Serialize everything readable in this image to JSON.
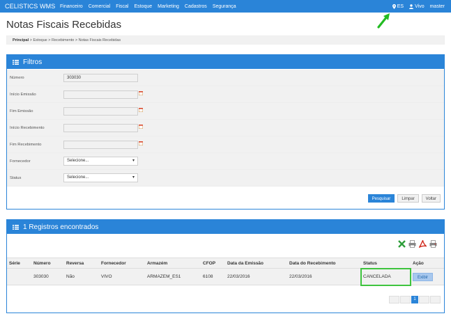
{
  "navbar": {
    "brand": "CELISTICS WMS",
    "menu": [
      "Financeiro",
      "Comercial",
      "Fiscal",
      "Estoque",
      "Marketing",
      "Cadastros",
      "Segurança"
    ],
    "location": "ES",
    "company": "Vivo",
    "user": "master"
  },
  "page": {
    "title": "Notas Fiscais Recebidas"
  },
  "breadcrumb": {
    "home": "Principal",
    "rest": " > Estoque > Recebimento > Notas Fiscais Recebidas"
  },
  "filters": {
    "title": "Filtros",
    "numero": {
      "label": "Número",
      "value": "303030"
    },
    "inicio_emissao": {
      "label": "Início Emissão",
      "value": ""
    },
    "fim_emissao": {
      "label": "Fim Emissão",
      "value": ""
    },
    "inicio_recebimento": {
      "label": "Início Recebimento",
      "value": ""
    },
    "fim_recebimento": {
      "label": "Fim Recebimento",
      "value": ""
    },
    "fornecedor": {
      "label": "Fornecedor",
      "value": "Selecione..."
    },
    "status": {
      "label": "Status",
      "value": "Selecione..."
    },
    "buttons": {
      "pesquisar": "Pesquisar",
      "limpar": "Limpar",
      "voltar": "Voltar"
    }
  },
  "results": {
    "title": "1 Registros encontrados",
    "tool_icons": [
      "excel-icon",
      "print-icon",
      "pdf-icon",
      "print-icon"
    ],
    "columns": [
      "Série",
      "Número",
      "Reversa",
      "Fornecedor",
      "Armazém",
      "CFOP",
      "Data da Emissão",
      "Data do Recebimento",
      "Status",
      "Ação"
    ],
    "rows": [
      {
        "serie": "",
        "numero": "303030",
        "reversa": "Não",
        "fornecedor": "VIVO",
        "armazem": "ARMAZEM_ES1",
        "cfop": "6108",
        "data_emissao": "22/03/2016",
        "data_recebimento": "22/03/2016",
        "status": "CANCELADA",
        "acao": "Exibir"
      }
    ],
    "pagination": {
      "current": "1"
    }
  },
  "colors": {
    "primary": "#2a84d8",
    "highlight": "#3ec43e",
    "annotation_arrow": "#22bb22"
  }
}
